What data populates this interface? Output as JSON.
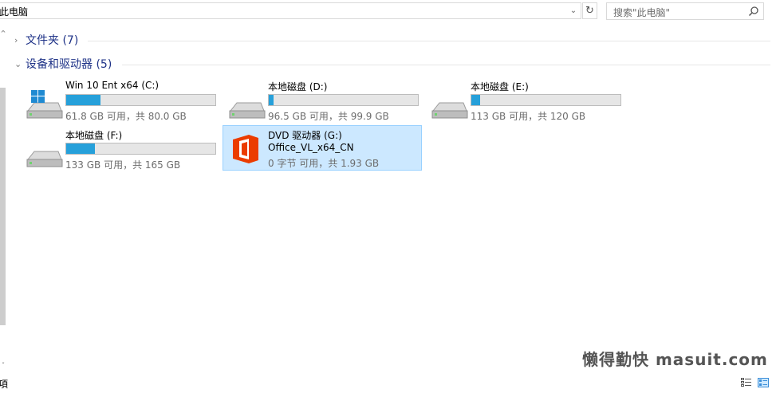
{
  "address": {
    "path": "此电脑"
  },
  "search": {
    "placeholder": "搜索\"此电脑\""
  },
  "groups": [
    {
      "label": "文件夹 (7)",
      "expanded": false
    },
    {
      "label": "设备和驱动器 (5)",
      "expanded": true
    }
  ],
  "drives": [
    {
      "name": "Win 10 Ent x64 (C:)",
      "info": "61.8 GB 可用，共 80.0 GB",
      "used_fraction": 0.228,
      "icon": "windows-drive-icon"
    },
    {
      "name": "本地磁盘 (D:)",
      "info": "96.5 GB 可用，共 99.9 GB",
      "used_fraction": 0.034,
      "icon": "hard-drive-icon"
    },
    {
      "name": "本地磁盘 (E:)",
      "info": "113 GB 可用，共 120 GB",
      "used_fraction": 0.058,
      "icon": "hard-drive-icon"
    },
    {
      "name": "本地磁盘 (F:)",
      "info": "133 GB 可用，共 165 GB",
      "used_fraction": 0.194,
      "icon": "hard-drive-icon"
    }
  ],
  "dvd": {
    "name": "DVD 驱动器 (G:)",
    "label": "Office_VL_x64_CN",
    "info": "0 字节 可用，共 1.93 GB",
    "icon": "office-logo-icon",
    "selected": true
  },
  "status": {
    "text": "項"
  },
  "watermark": "懒得勤快 masuit.com",
  "colors": {
    "accent": "#26a0da",
    "group_title": "#1e3287",
    "selection": "#cce8ff",
    "office_red": "#eb3c00"
  }
}
